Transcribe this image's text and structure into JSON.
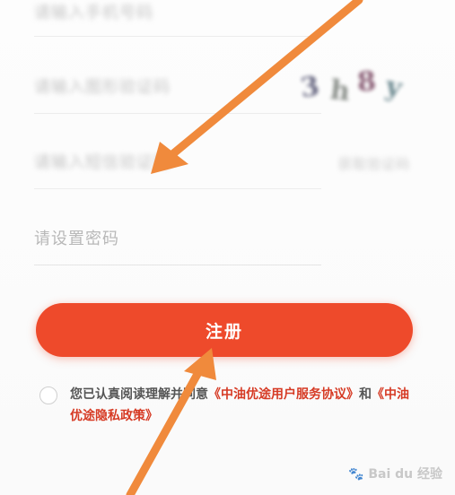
{
  "form": {
    "field1_placeholder": "请输入手机号码",
    "field2_placeholder": "请输入图形验证码",
    "captcha_chars": [
      "3",
      "h",
      "8",
      "y"
    ],
    "field3_placeholder": "请输入短信验证码",
    "send_code_label": "获取验证码",
    "password_placeholder": "请设置密码"
  },
  "register": {
    "label": "注册"
  },
  "agreement": {
    "prefix": "您已认真阅读理解并同意",
    "user_agreement": "《中油优途用户服务协议》",
    "and": "和",
    "privacy_policy": "《中油优途隐私政策》"
  },
  "watermark": {
    "text": "Bai du 经验"
  },
  "colors": {
    "accent": "#ee4a2b",
    "link": "#d63a24",
    "arrow": "#f08a3c"
  }
}
